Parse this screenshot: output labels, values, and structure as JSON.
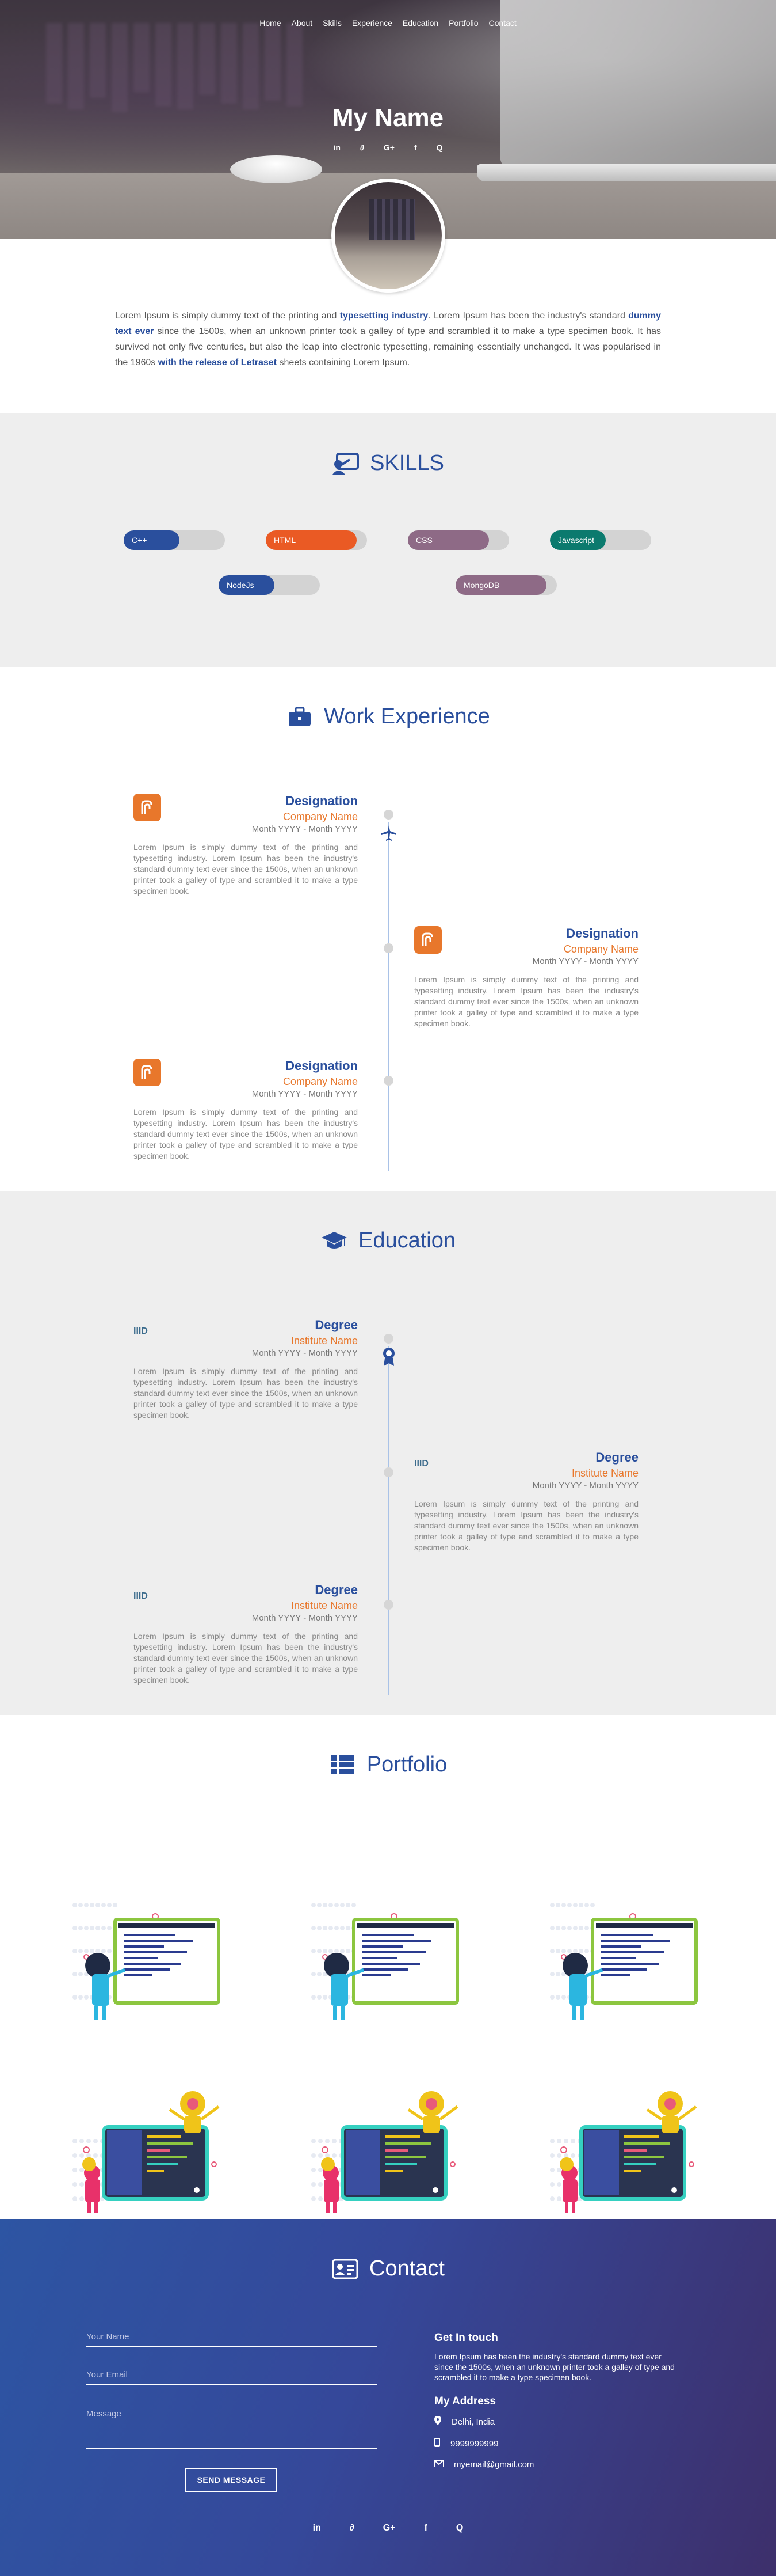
{
  "nav": [
    "Home",
    "About",
    "Skills",
    "Experience",
    "Education",
    "Portfolio",
    "Contact"
  ],
  "hero": {
    "name": "My Name",
    "social": [
      "in",
      "∂",
      "G+",
      "f",
      "Q"
    ]
  },
  "about": {
    "p1": "Lorem Ipsum is simply dummy text of the printing and ",
    "b1": "typesetting industry",
    "p2": ". Lorem Ipsum has been the industry's standard ",
    "b2": "dummy text ever",
    "p3": " since the 1500s, when an unknown printer took a galley of type and scrambled it to make a type specimen book. It has survived not only five centuries, but also the leap into electronic typesetting, remaining essentially unchanged. It was popularised in the 1960s ",
    "b3": "with the release of Letraset",
    "p4": " sheets containing Lorem Ipsum."
  },
  "skills": {
    "title": "SKILLS",
    "items": [
      {
        "label": "C++",
        "level": 0.55,
        "color": "#2a4f9d"
      },
      {
        "label": "HTML",
        "level": 0.9,
        "color": "#ea5a24"
      },
      {
        "label": "CSS",
        "level": 0.8,
        "color": "#8e6a86"
      },
      {
        "label": "Javascript",
        "level": 0.55,
        "color": "#0b7a6e"
      },
      {
        "label": "NodeJs",
        "level": 0.55,
        "color": "#2a4f9d"
      },
      {
        "label": "MongoDB",
        "level": 0.9,
        "color": "#8e6a86"
      }
    ]
  },
  "work": {
    "title": "Work Experience",
    "entries": [
      {
        "title": "Designation",
        "org": "Company Name",
        "dates": "Month YYYY - Month YYYY",
        "text": "Lorem Ipsum is simply dummy text of the printing and typesetting industry. Lorem Ipsum has been the industry's standard dummy text ever since the 1500s, when an unknown printer took a galley of type and scrambled it to make a type specimen book."
      },
      {
        "title": "Designation",
        "org": "Company Name",
        "dates": "Month YYYY - Month YYYY",
        "text": "Lorem Ipsum is simply dummy text of the printing and typesetting industry. Lorem Ipsum has been the industry's standard dummy text ever since the 1500s, when an unknown printer took a galley of type and scrambled it to make a type specimen book."
      },
      {
        "title": "Designation",
        "org": "Company Name",
        "dates": "Month YYYY - Month YYYY",
        "text": "Lorem Ipsum is simply dummy text of the printing and typesetting industry. Lorem Ipsum has been the industry's standard dummy text ever since the 1500s, when an unknown printer took a galley of type and scrambled it to make a type specimen book."
      }
    ]
  },
  "education": {
    "title": "Education",
    "logo_text": "IIID",
    "entries": [
      {
        "title": "Degree",
        "org": "Institute Name",
        "dates": "Month YYYY - Month YYYY",
        "text": "Lorem Ipsum is simply dummy text of the printing and typesetting industry. Lorem Ipsum has been the industry's standard dummy text ever since the 1500s, when an unknown printer took a galley of type and scrambled it to make a type specimen book."
      },
      {
        "title": "Degree",
        "org": "Institute Name",
        "dates": "Month YYYY - Month YYYY",
        "text": "Lorem Ipsum is simply dummy text of the printing and typesetting industry. Lorem Ipsum has been the industry's standard dummy text ever since the 1500s, when an unknown printer took a galley of type and scrambled it to make a type specimen book."
      },
      {
        "title": "Degree",
        "org": "Institute Name",
        "dates": "Month YYYY - Month YYYY",
        "text": "Lorem Ipsum is simply dummy text of the printing and typesetting industry. Lorem Ipsum has been the industry's standard dummy text ever since the 1500s, when an unknown printer took a galley of type and scrambled it to make a type specimen book."
      }
    ]
  },
  "portfolio": {
    "title": "Portfolio"
  },
  "contact": {
    "title": "Contact",
    "name_placeholder": "Your Name",
    "email_placeholder": "Your Email",
    "message_placeholder": "Message",
    "send_label": "SEND MESSAGE",
    "touch_title": "Get In touch",
    "touch_text": "Lorem Ipsum has been the industry's standard dummy text ever since the 1500s, when an unknown printer took a galley of type and scrambled it to make a type specimen book.",
    "address_title": "My Address",
    "location": "Delhi, India",
    "phone": "9999999999",
    "email": "myemail@gmail.com"
  },
  "colors": {
    "primary": "#2a4f9d",
    "accent": "#e8772b",
    "grey_bg": "#eeeeee"
  }
}
